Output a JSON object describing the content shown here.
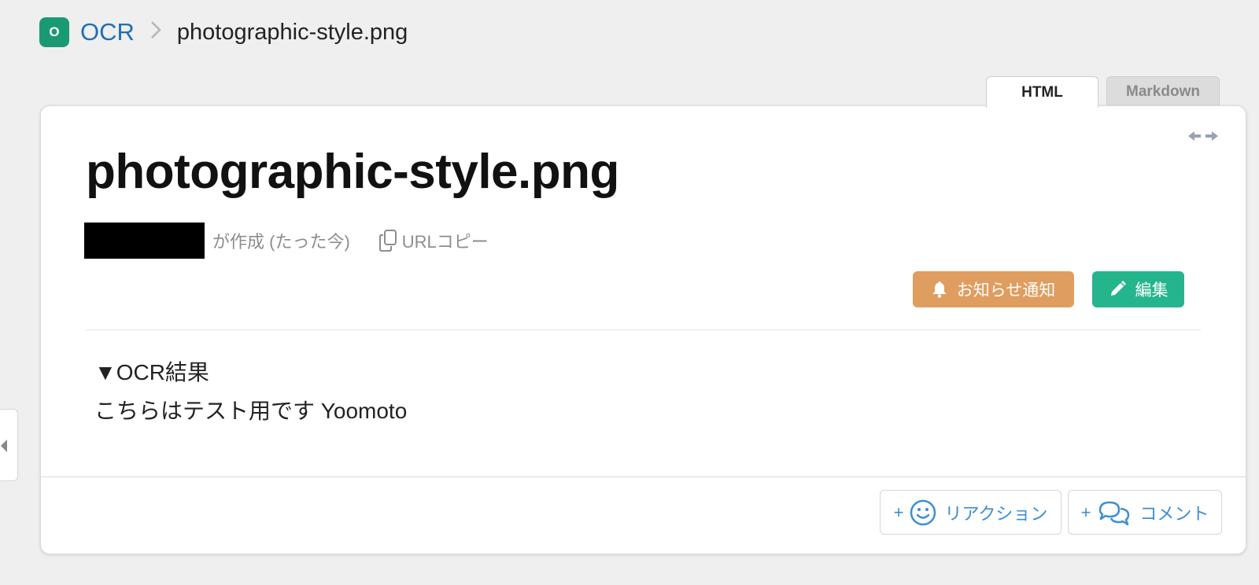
{
  "breadcrumb": {
    "app_badge": "O",
    "parent": "OCR",
    "current": "photographic-style.png"
  },
  "tabs": [
    {
      "label": "HTML",
      "active": true
    },
    {
      "label": "Markdown",
      "active": false
    }
  ],
  "post": {
    "title": "photographic-style.png",
    "created_by": "が作成 (たった今)",
    "url_copy": "URLコピー",
    "notify_label": "お知らせ通知",
    "edit_label": "編集",
    "content": [
      "▼OCR結果",
      "こちらはテスト用です Yoomoto"
    ]
  },
  "footer": {
    "plus": "+",
    "reaction_label": "リアクション",
    "comment_label": "コメント"
  },
  "icons": {
    "expand": "arrows-horizontal-icon",
    "copy": "copy-icon",
    "bell": "bell-icon",
    "pencil": "pencil-icon",
    "smile": "smile-icon",
    "comment": "comment-icon",
    "side_toggle": "caret-left-icon"
  },
  "colors": {
    "badge": "#1a9a73",
    "link": "#1f6fb5",
    "notify": "#df9d5f",
    "edit": "#24b58c",
    "footer_accent": "#3a8fd6"
  }
}
